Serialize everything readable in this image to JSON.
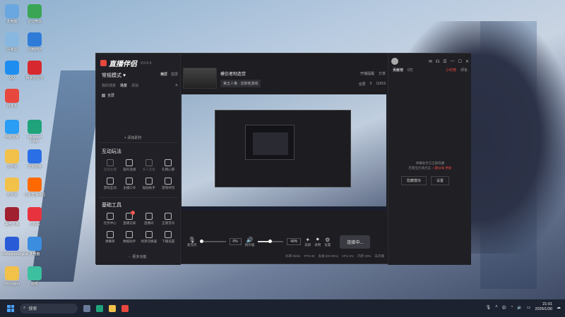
{
  "desktop": {
    "icons": [
      {
        "label": "此电脑",
        "color": "#6aa7e0"
      },
      {
        "label": "回收站",
        "color": "#88b8e0"
      },
      {
        "label": "QQ",
        "color": "#1e8df0"
      },
      {
        "label": "拼多多",
        "color": "#e8473e"
      },
      {
        "label": "电脑管家",
        "color": "#2a9df4"
      },
      {
        "label": "文件夹",
        "color": "#f2c14a"
      },
      {
        "label": "文件夹",
        "color": "#f2c14a"
      },
      {
        "label": "第五人格",
        "color": "#a02030"
      },
      {
        "label": "WallpaperEngine",
        "color": "#2a5bd7"
      },
      {
        "label": "chengguo",
        "color": "#f2c14a"
      },
      {
        "label": "企业微信",
        "color": "#3aa655"
      },
      {
        "label": "应用商店",
        "color": "#2f7bd8"
      },
      {
        "label": "网易云音乐",
        "color": "#d8282f"
      },
      {
        "label": "Microsoft Edge",
        "color": "#1fa37a"
      },
      {
        "label": "夸克网盘",
        "color": "#2b6fe6"
      },
      {
        "label": "斗鱼直播伴侣",
        "color": "#ff6a00"
      },
      {
        "label": "小红书",
        "color": "#e8333f"
      },
      {
        "label": "此电脑",
        "color": "#3b8de0"
      },
      {
        "label": "贴纸",
        "color": "#3cc0a0"
      },
      {
        "label": "剪映",
        "color": "#1a1a1a"
      }
    ]
  },
  "app": {
    "logo_text": "直播伴侣",
    "version": "9.5.5.4",
    "mode_title": "常规模式 ♥",
    "mode_toggle": [
      "横屏",
      "竖屏"
    ],
    "scene_tabs": [
      "我的场景",
      "场景",
      "添加"
    ],
    "scene_add": "+",
    "scene_item": "全屏",
    "add_source": "+ 添加素材",
    "section_interactive": "互动玩法",
    "interactive_items": [
      {
        "label": "连线主播",
        "dim": true
      },
      {
        "label": "观众连线",
        "dim": false
      },
      {
        "label": "多人连麦",
        "dim": true
      },
      {
        "label": "礼物心愿",
        "dim": false
      },
      {
        "label": "游戏互动",
        "dim": false
      },
      {
        "label": "主播口令",
        "dim": false
      },
      {
        "label": "贴贴助手",
        "dim": false
      },
      {
        "label": "游戏共玩",
        "dim": false
      }
    ],
    "section_tools": "基础工具",
    "tool_items": [
      {
        "label": "任务中心",
        "badge": ""
      },
      {
        "label": "直播记录",
        "badge": "1"
      },
      {
        "label": "直播间",
        "badge": ""
      },
      {
        "label": "正版音乐",
        "badge": ""
      },
      {
        "label": "弹幕库",
        "badge": ""
      },
      {
        "label": "数据助手",
        "badge": ""
      },
      {
        "label": "场景切换器",
        "badge": ""
      },
      {
        "label": "下播设置",
        "badge": ""
      }
    ],
    "more_label": "··· 更多功能",
    "room": {
      "title": "模仿者制造觉",
      "category": "第五人格 · 去除他游戏"
    },
    "room_actions": [
      "开播提醒",
      "分享"
    ],
    "room_stats": [
      "全屏",
      "0",
      "11919"
    ],
    "controls": {
      "mic_label": "麦克风",
      "mic_pct": "0%",
      "mic_level": 0.05,
      "speaker_label": "扬声器",
      "speaker_pct": "49%",
      "speaker_level": 0.49,
      "beauty_label": "美颜",
      "record_label": "录制",
      "settings_label": "设置",
      "live_button": "连接中..."
    },
    "status": [
      "码率:0kb/s",
      "FPS:30",
      "丢帧:0(0.00%)",
      "CPU:4%",
      "内存:20%",
      "未开播"
    ],
    "right": {
      "tabs": [
        "贡献榜",
        "0万",
        "小时榜",
        "评论"
      ],
      "assist_text_1": "弹幕助手已全部隐藏",
      "assist_text_2": "若需显示请点击",
      "assist_link_1": "一键分离",
      "assist_link_2": "更新",
      "buttons": [
        "隐藏模块",
        "设置"
      ]
    }
  },
  "taskbar": {
    "search_placeholder": "搜索",
    "tray_items": [
      "中"
    ],
    "time": "21:01",
    "date": "2026/1/30"
  },
  "colors": {
    "accent": "#e8473e",
    "panel": "#1d1d22",
    "taskbar": "#1c2230"
  }
}
